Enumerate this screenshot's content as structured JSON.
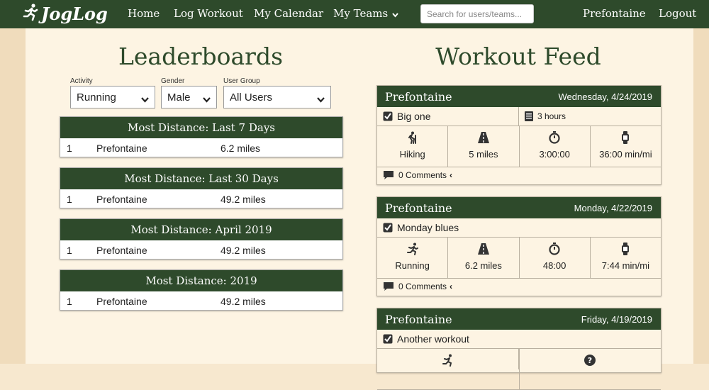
{
  "nav": {
    "brand": "JogLog",
    "links": [
      "Home",
      "Log Workout",
      "My Calendar",
      "My Teams"
    ],
    "search_placeholder": "Search for users/teams...",
    "user": "Prefontaine",
    "logout": "Logout"
  },
  "leaderboards": {
    "title": "Leaderboards",
    "filters": {
      "activity_label": "Activity",
      "activity_value": "Running",
      "gender_label": "Gender",
      "gender_value": "Male",
      "group_label": "User Group",
      "group_value": "All Users"
    },
    "cards": [
      {
        "title": "Most Distance: Last 7 Days",
        "rank": "1",
        "user": "Prefontaine",
        "value": "6.2 miles"
      },
      {
        "title": "Most Distance: Last 30 Days",
        "rank": "1",
        "user": "Prefontaine",
        "value": "49.2 miles"
      },
      {
        "title": "Most Distance: April 2019",
        "rank": "1",
        "user": "Prefontaine",
        "value": "49.2 miles"
      },
      {
        "title": "Most Distance: 2019",
        "rank": "1",
        "user": "Prefontaine",
        "value": "49.2 miles"
      }
    ]
  },
  "feed": {
    "title": "Workout Feed",
    "workouts": [
      {
        "user": "Prefontaine",
        "date": "Wednesday, 4/24/2019",
        "title": "Big one",
        "duration": "3 hours",
        "activity": "Hiking",
        "distance": "5 miles",
        "time": "3:00:00",
        "pace": "36:00 min/mi",
        "comments": "0 Comments"
      },
      {
        "user": "Prefontaine",
        "date": "Monday, 4/22/2019",
        "title": "Monday blues",
        "activity": "Running",
        "distance": "6.2 miles",
        "time": "48:00",
        "pace": "7:44 min/mi",
        "comments": "0 Comments"
      },
      {
        "user": "Prefontaine",
        "date": "Friday, 4/19/2019",
        "title": "Another workout"
      }
    ]
  },
  "colors": {
    "nav_bg": "#2e4a2b",
    "page_bg": "#fdf4e3",
    "accent": "#2e4a2b"
  }
}
